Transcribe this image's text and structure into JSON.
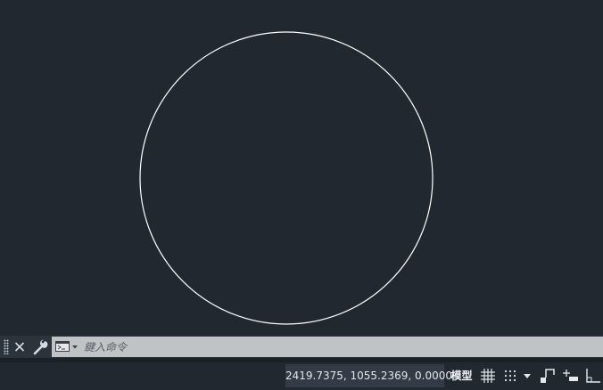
{
  "drawing": {
    "entities": [
      {
        "type": "circle",
        "color": "#ffffff"
      }
    ]
  },
  "command_line": {
    "close_icon": "close-icon",
    "customize_icon": "wrench-icon",
    "history_icon": "command-window-icon",
    "placeholder": "鍵入命令",
    "value": ""
  },
  "status_bar": {
    "coordinates": "2419.7375, 1055.2369, 0.0000",
    "model_label": "模型",
    "icons": [
      "grid-icon",
      "snap-icon",
      "dropdown-arrow-icon",
      "infer-constraints-icon",
      "dynamic-input-icon",
      "ortho-icon"
    ]
  },
  "colors": {
    "canvas_background": "#212830",
    "command_input_background": "#c0c3c6",
    "coordinates_background": "#333b47"
  }
}
